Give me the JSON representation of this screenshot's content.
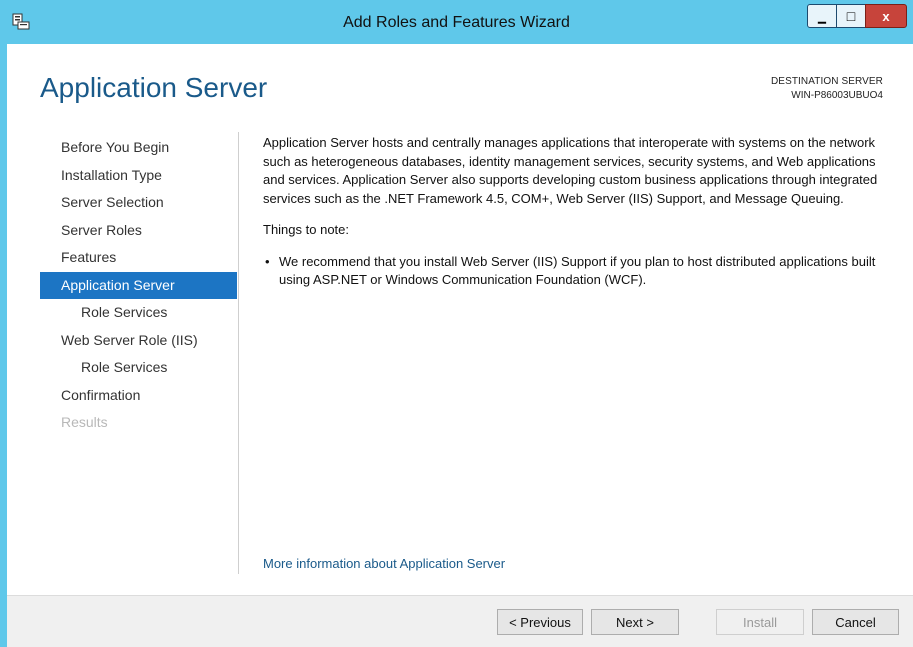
{
  "window": {
    "title": "Add Roles and Features Wizard",
    "controls": {
      "minimize": "▁",
      "maximize": "□",
      "close": "x"
    }
  },
  "page": {
    "title": "Application Server",
    "destination_label": "DESTINATION SERVER",
    "destination_server": "WIN-P86003UBUO4"
  },
  "nav": {
    "items": [
      {
        "label": "Before You Begin"
      },
      {
        "label": "Installation Type"
      },
      {
        "label": "Server Selection"
      },
      {
        "label": "Server Roles"
      },
      {
        "label": "Features"
      },
      {
        "label": "Application Server"
      },
      {
        "label": "Role Services"
      },
      {
        "label": "Web Server Role (IIS)"
      },
      {
        "label": "Role Services"
      },
      {
        "label": "Confirmation"
      },
      {
        "label": "Results"
      }
    ],
    "selected": "Application Server"
  },
  "content": {
    "description": "Application Server hosts and centrally manages applications that interoperate with systems on the network such as heterogeneous databases, identity management services, security systems, and Web applications and services. Application Server also supports developing custom business applications through integrated services such as the .NET Framework 4.5, COM+, Web Server (IIS) Support, and Message Queuing.",
    "notes_heading": "Things to note:",
    "notes": [
      "We recommend that you install Web Server (IIS) Support if you plan to host distributed applications built using ASP.NET or Windows Communication Foundation (WCF)."
    ],
    "more_info_link": "More information about Application Server"
  },
  "footer": {
    "previous": "< Previous",
    "next": "Next >",
    "install": "Install",
    "cancel": "Cancel"
  },
  "colors": {
    "title_bar": "#5fc8ea",
    "accent": "#1c75c4",
    "heading": "#1a5a8a",
    "close_button": "#c7443b"
  }
}
